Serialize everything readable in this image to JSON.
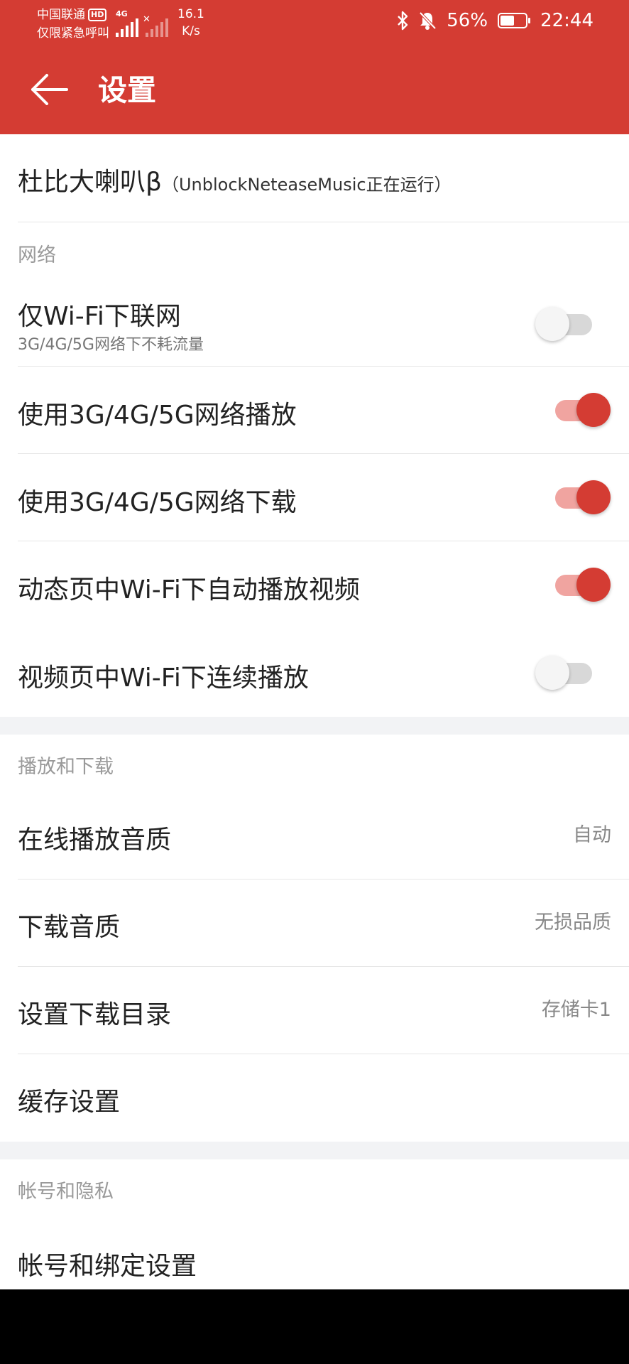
{
  "status_bar": {
    "carrier": "中国联通",
    "hd_badge": "HD",
    "emergency_note": "仅限紧急呼叫",
    "network_type": "4G",
    "speed_value": "16.1",
    "speed_unit": "K/s",
    "battery_percent": "56%",
    "battery_level": 0.56,
    "time": "22:44",
    "icons": [
      "bluetooth-icon",
      "mute-bell-icon",
      "battery-icon"
    ]
  },
  "header": {
    "back_icon": "back-arrow-icon",
    "title": "设置",
    "accent_color": "#d43c33"
  },
  "plugin_row": {
    "label": "杜比大喇叭β",
    "note": "（UnblockNeteaseMusic正在运行）"
  },
  "network_section": {
    "title": "网络",
    "items": [
      {
        "label": "仅Wi-Fi下联网",
        "subtitle": "3G/4G/5G网络下不耗流量",
        "toggle": false
      },
      {
        "label": "使用3G/4G/5G网络播放",
        "toggle": true
      },
      {
        "label": "使用3G/4G/5G网络下载",
        "toggle": true
      },
      {
        "label": "动态页中Wi-Fi下自动播放视频",
        "toggle": true
      },
      {
        "label": "视频页中Wi-Fi下连续播放",
        "toggle": false
      }
    ]
  },
  "playback_section": {
    "title": "播放和下载",
    "items": [
      {
        "label": "在线播放音质",
        "value": "自动"
      },
      {
        "label": "下载音质",
        "value": "无损品质"
      },
      {
        "label": "设置下载目录",
        "value": "存储卡1"
      },
      {
        "label": "缓存设置",
        "value": ""
      }
    ]
  },
  "account_section": {
    "title": "帐号和隐私",
    "items": [
      {
        "label": "帐号和绑定设置"
      }
    ]
  }
}
